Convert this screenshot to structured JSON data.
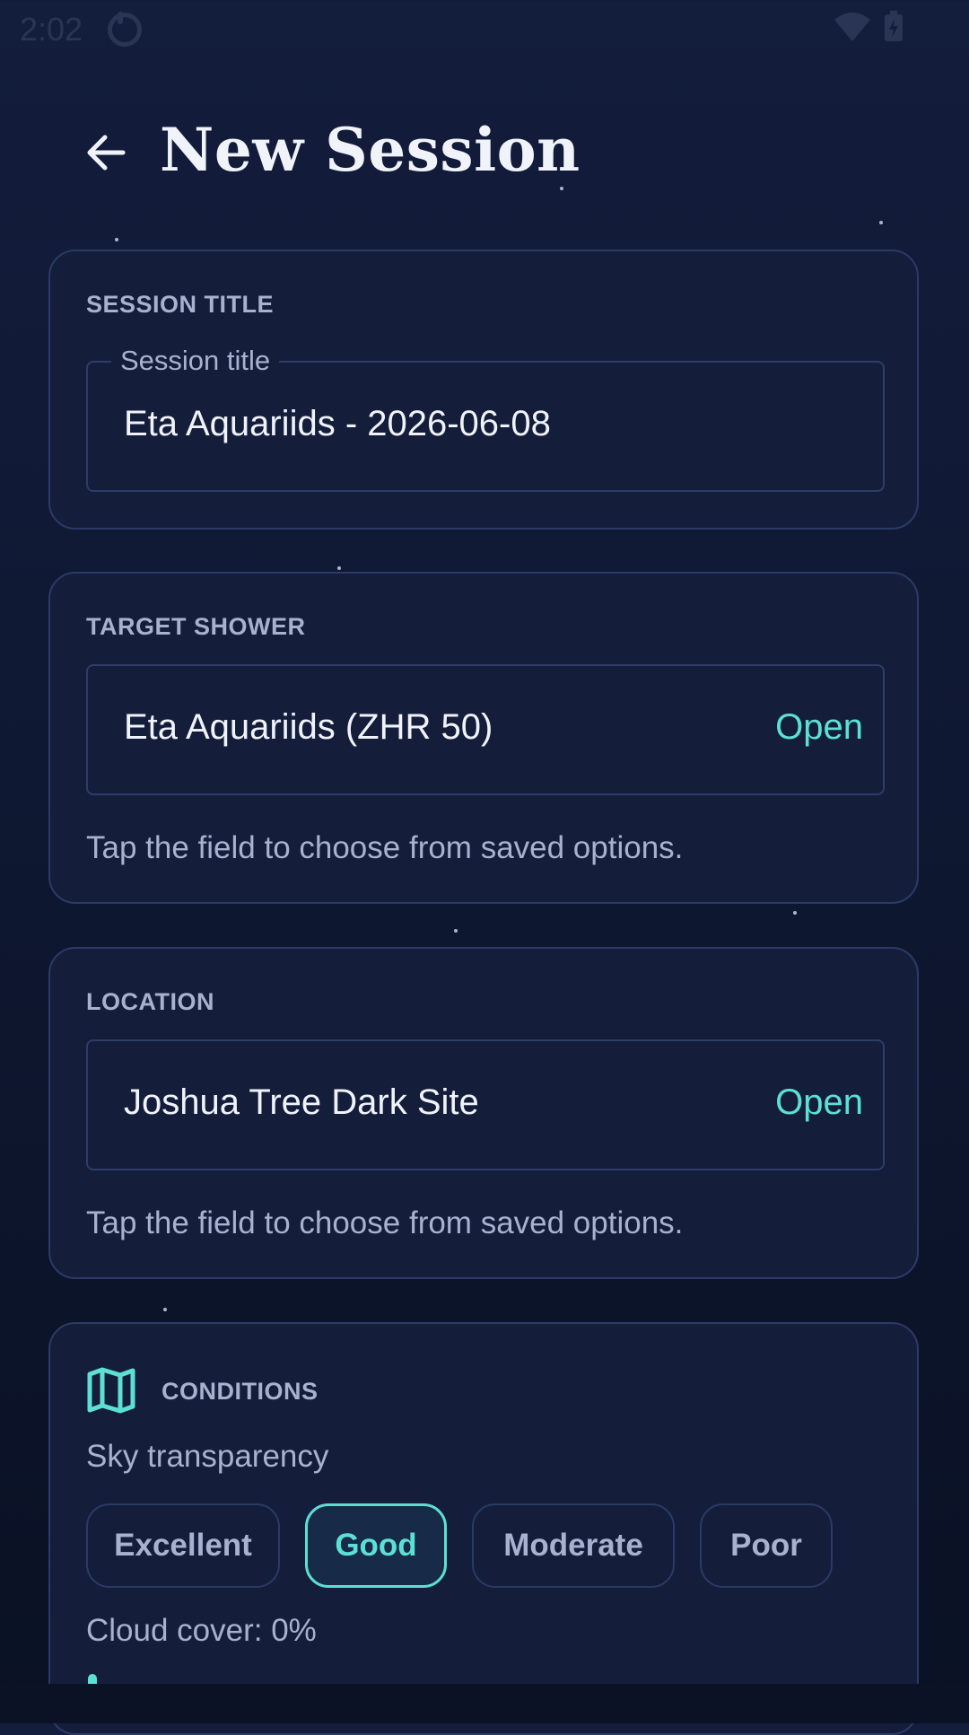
{
  "status_bar": {
    "time": "2:02"
  },
  "header": {
    "title": "New Session"
  },
  "session_title_card": {
    "label": "SESSION TITLE",
    "field_label": "Session title",
    "field_value": "Eta Aquariids - 2026-06-08"
  },
  "target_shower_card": {
    "label": "TARGET SHOWER",
    "field_value": "Eta Aquariids (ZHR 50)",
    "action": "Open",
    "helper": "Tap the field to choose from saved options."
  },
  "location_card": {
    "label": "LOCATION",
    "field_value": "Joshua Tree Dark Site",
    "action": "Open",
    "helper": "Tap the field to choose from saved options."
  },
  "conditions_card": {
    "label": "CONDITIONS",
    "sky_transparency_label": "Sky transparency",
    "options": [
      "Excellent",
      "Good",
      "Moderate",
      "Poor"
    ],
    "selected": "Good",
    "cloud_cover_label": "Cloud cover: 0%",
    "cloud_cover_value": 0
  },
  "colors": {
    "accent": "#5ce0d4",
    "card_bg": "#141e3b",
    "card_border": "#2b3a66",
    "muted_text": "#a8b2cf"
  }
}
